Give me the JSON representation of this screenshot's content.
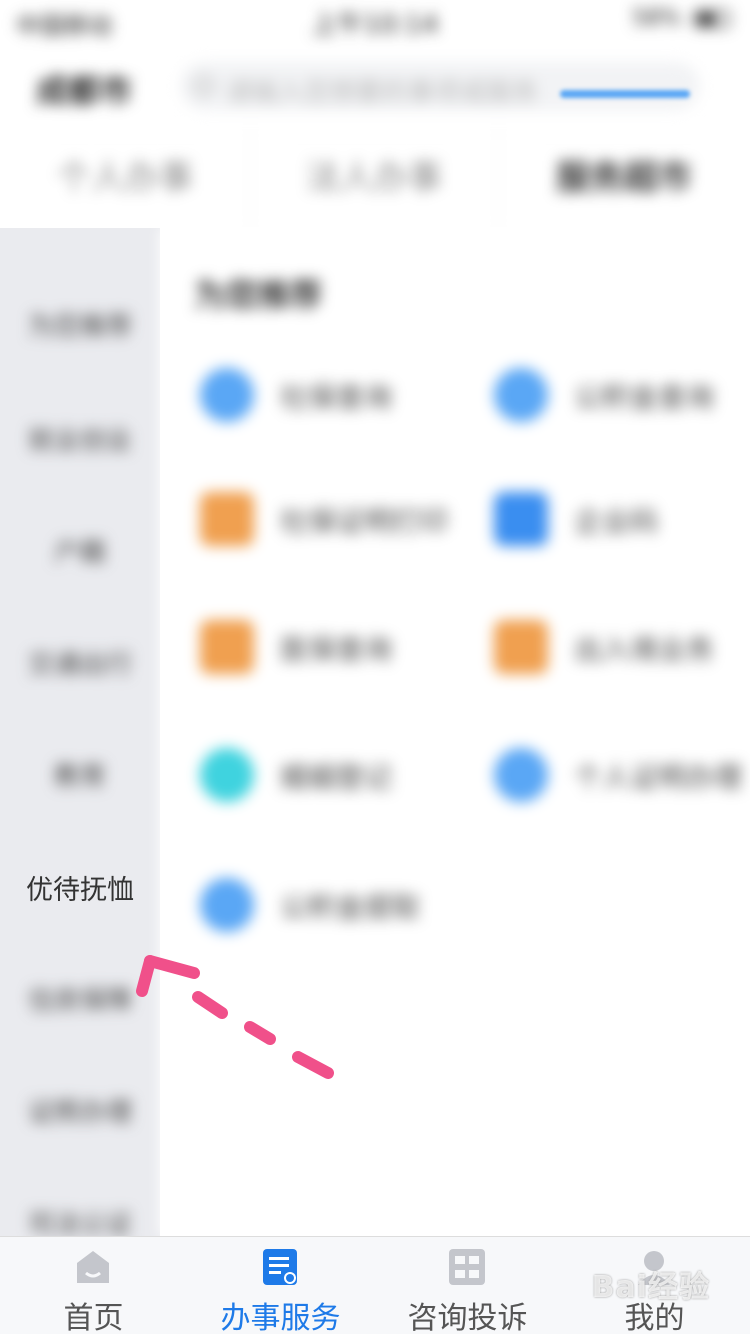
{
  "status_bar": {
    "carrier": "中国移动",
    "time": "上午10:14",
    "battery": "58%"
  },
  "header": {
    "region": "成都市",
    "search_placeholder": "请输入您想要的事项或服务"
  },
  "tabs": [
    {
      "label": "个人办事"
    },
    {
      "label": "法人办事"
    },
    {
      "label": "服务超市"
    }
  ],
  "sidebar": {
    "items": [
      {
        "label": "为您推荐"
      },
      {
        "label": "就业创业"
      },
      {
        "label": "户籍"
      },
      {
        "label": "交通出行"
      },
      {
        "label": "教育"
      },
      {
        "label": "优待抚恤"
      },
      {
        "label": "住房保障"
      },
      {
        "label": "证照办理"
      },
      {
        "label": "司法公证"
      }
    ]
  },
  "content": {
    "section_title": "为您推荐",
    "services": [
      {
        "label": "社保查询",
        "icon": "circle-icon",
        "color": "#5aa7f5"
      },
      {
        "label": "公积金查询",
        "icon": "circle-icon",
        "color": "#5aa7f5"
      },
      {
        "label": "社保证明打印",
        "icon": "printer-icon",
        "color": "#f0a050"
      },
      {
        "label": "企业码",
        "icon": "company-icon",
        "color": "#3a8ef0"
      },
      {
        "label": "医保查询",
        "icon": "card-icon",
        "color": "#f0a050"
      },
      {
        "label": "出入境业务",
        "icon": "card-icon",
        "color": "#f0a050"
      },
      {
        "label": "婚姻登记",
        "icon": "circle-icon",
        "color": "#3fd3df"
      },
      {
        "label": "个人证明办理",
        "icon": "circle-icon",
        "color": "#5aa7f5"
      },
      {
        "label": "公积金提取",
        "icon": "circle-icon",
        "color": "#5aa7f5"
      }
    ]
  },
  "bottom_nav": [
    {
      "label": "首页",
      "icon": "home-icon"
    },
    {
      "label": "办事服务",
      "icon": "document-icon",
      "active": true
    },
    {
      "label": "咨询投诉",
      "icon": "chat-icon"
    },
    {
      "label": "我的",
      "icon": "user-icon"
    }
  ],
  "watermark": "Bai经验",
  "colors": {
    "accent": "#1e7ae8",
    "arrow": "#f0508a"
  }
}
